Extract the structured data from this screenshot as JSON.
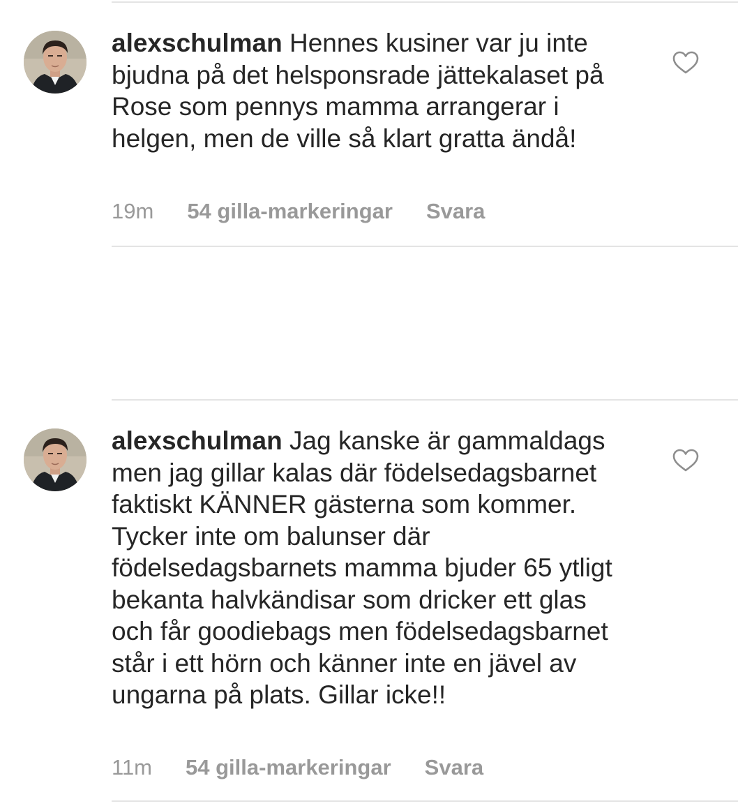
{
  "comments": [
    {
      "username": "alexschulman",
      "text": " Hennes kusiner var ju inte bjudna på det helsponsrade jättekalaset på Rose som pennys mamma arrangerar i helgen, men de ville så klart gratta ändå!",
      "time": "19m",
      "likes": "54 gilla-markeringar",
      "reply": "Svara",
      "like_icon": "heart-outline-icon"
    },
    {
      "username": "alexschulman",
      "text": " Jag kanske är gammaldags men jag gillar kalas där födelsedagsbarnet faktiskt KÄNNER gästerna som kommer. Tycker inte om balunser där födelsedagsbarnets mamma bjuder 65 ytligt bekanta halvkändisar som dricker ett glas och får goodiebags men födelsedagsbarnet står i ett hörn och känner inte en jävel av ungarna på plats. Gillar icke!!",
      "time": "11m",
      "likes": "54 gilla-markeringar",
      "reply": "Svara",
      "like_icon": "heart-outline-icon"
    }
  ],
  "colors": {
    "text": "#262626",
    "meta": "#999999",
    "divider": "#e4e4e4",
    "heart_stroke": "#8e8e8e"
  }
}
